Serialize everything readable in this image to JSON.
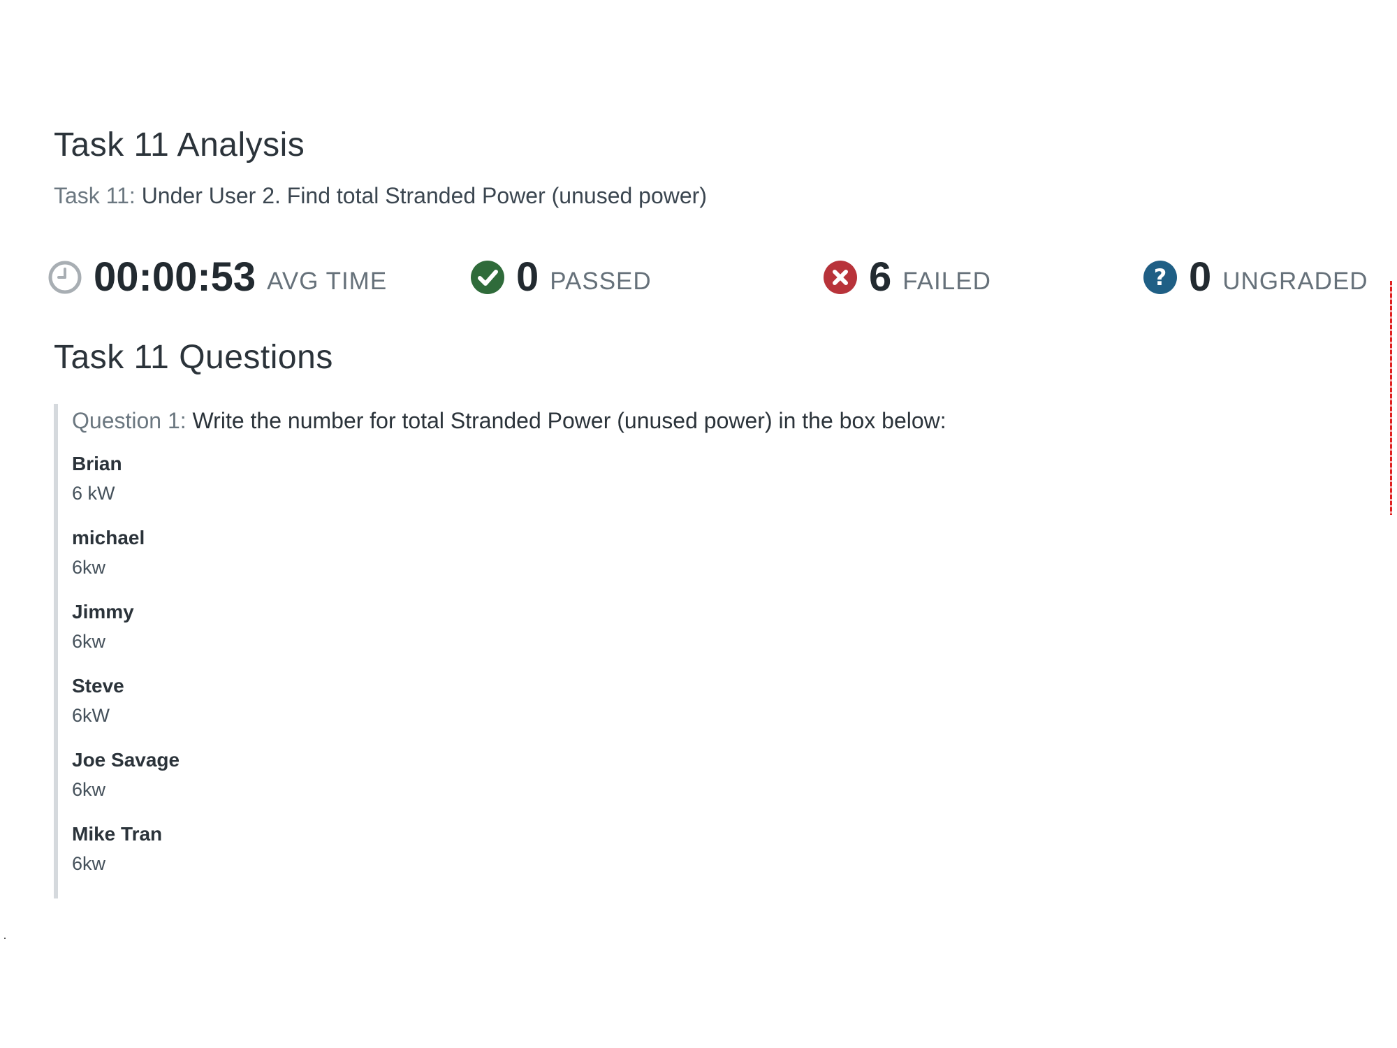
{
  "header": {
    "title": "Task 11 Analysis",
    "task_prefix": "Task 11:",
    "task_text": "Under User 2. Find total Stranded Power (unused power)"
  },
  "stats": {
    "avg_time": {
      "value": "00:00:53",
      "label": "AVG TIME",
      "icon": "clock-icon"
    },
    "passed": {
      "value": "0",
      "label": "PASSED",
      "icon": "check-circle-icon"
    },
    "failed": {
      "value": "6",
      "label": "FAILED",
      "icon": "x-circle-icon"
    },
    "ungraded": {
      "value": "0",
      "label": "UNGRADED",
      "icon": "question-circle-icon"
    }
  },
  "colors": {
    "clock": "#a8aeb3",
    "passed": "#2f6b3a",
    "failed": "#b8333a",
    "ungraded": "#1f5f85",
    "border": "#d5d9dd"
  },
  "questions": {
    "title": "Task 11 Questions",
    "items": [
      {
        "prefix": "Question 1:",
        "text": "Write the number for total Stranded Power (unused power) in the box below:",
        "answers": [
          {
            "name": "Brian",
            "value": "6 kW"
          },
          {
            "name": "michael",
            "value": "6kw"
          },
          {
            "name": "Jimmy",
            "value": "6kw"
          },
          {
            "name": "Steve",
            "value": "6kW"
          },
          {
            "name": "Joe Savage",
            "value": "6kw"
          },
          {
            "name": "Mike Tran",
            "value": "6kw"
          }
        ]
      }
    ]
  }
}
